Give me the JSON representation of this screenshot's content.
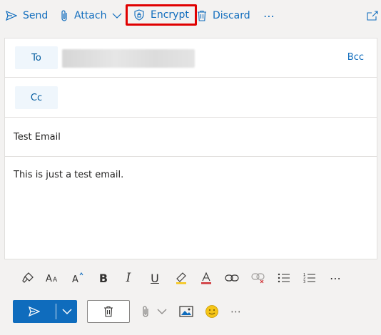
{
  "toolbar": {
    "send_label": "Send",
    "attach_label": "Attach",
    "encrypt_label": "Encrypt",
    "discard_label": "Discard",
    "more_label": "⋯"
  },
  "compose": {
    "to_label": "To",
    "cc_label": "Cc",
    "bcc_label": "Bcc",
    "subject": "Test Email",
    "body": "This is just a test email."
  },
  "format_toolbar": {
    "icons": [
      "format-painter-icon",
      "font-size-icon",
      "grow-font-icon",
      "bold-icon",
      "italic-icon",
      "underline-icon",
      "highlight-icon",
      "font-color-icon",
      "insert-link-icon",
      "remove-link-icon",
      "bullets-icon",
      "numbering-icon",
      "more-options-icon"
    ],
    "bold_glyph": "B",
    "italic_glyph": "I",
    "underline_glyph": "U",
    "more_glyph": "⋯"
  },
  "bottom_bar": {
    "more_glyph": "⋯"
  },
  "colors": {
    "accent": "#0f6cbd",
    "highlight_box": "#e00000",
    "emoji": "#f5c518"
  }
}
